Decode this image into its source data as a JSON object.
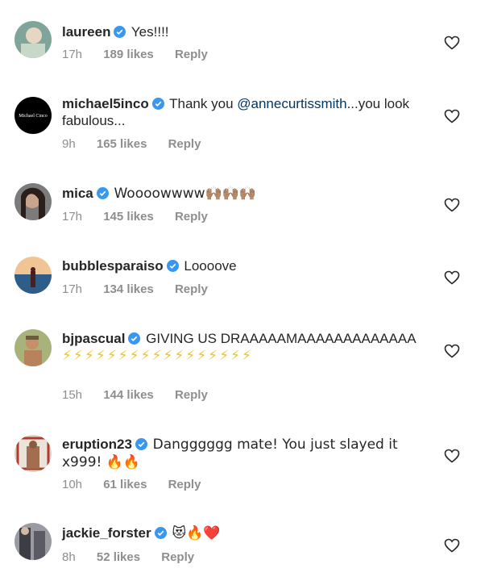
{
  "comments": [
    {
      "username": "laureen",
      "text": "Yes!!!!",
      "time": "17h",
      "likes": "189 likes",
      "reply": "Reply"
    },
    {
      "username": "michael5inco",
      "text_pre": "Thank you ",
      "mention": "@annecurtissmith",
      "text_post": "...you look fabulous...",
      "time": "9h",
      "likes": "165 likes",
      "reply": "Reply",
      "avatar_text": "Michael Cinco"
    },
    {
      "username": "mica",
      "text": "Woooowwww🙌🏽🙌🏽🙌🏽",
      "time": "17h",
      "likes": "145 likes",
      "reply": "Reply"
    },
    {
      "username": "bubblesparaiso",
      "text": "Loooove",
      "time": "17h",
      "likes": "134 likes",
      "reply": "Reply"
    },
    {
      "username": "bjpascual",
      "text": "GIVING US DRAAAAAMAAAAAAAAAAAAA",
      "bolts": "⚡⚡⚡⚡⚡⚡⚡⚡⚡⚡⚡⚡⚡⚡⚡⚡⚡",
      "time": "15h",
      "likes": "144 likes",
      "reply": "Reply"
    },
    {
      "username": "eruption23",
      "text": "Dangggggg mate! You just slayed it x999! 🔥🔥",
      "time": "10h",
      "likes": "61 likes",
      "reply": "Reply"
    },
    {
      "username": "jackie_forster",
      "text": "😻🔥❤️",
      "time": "8h",
      "likes": "52 likes",
      "reply": "Reply"
    }
  ],
  "colors": {
    "text": "#262626",
    "meta": "#8e8e8e",
    "verified": "#3897f0",
    "mention": "#003569"
  },
  "icons": {
    "verified": "verified-badge-icon",
    "like": "heart-outline-icon"
  }
}
